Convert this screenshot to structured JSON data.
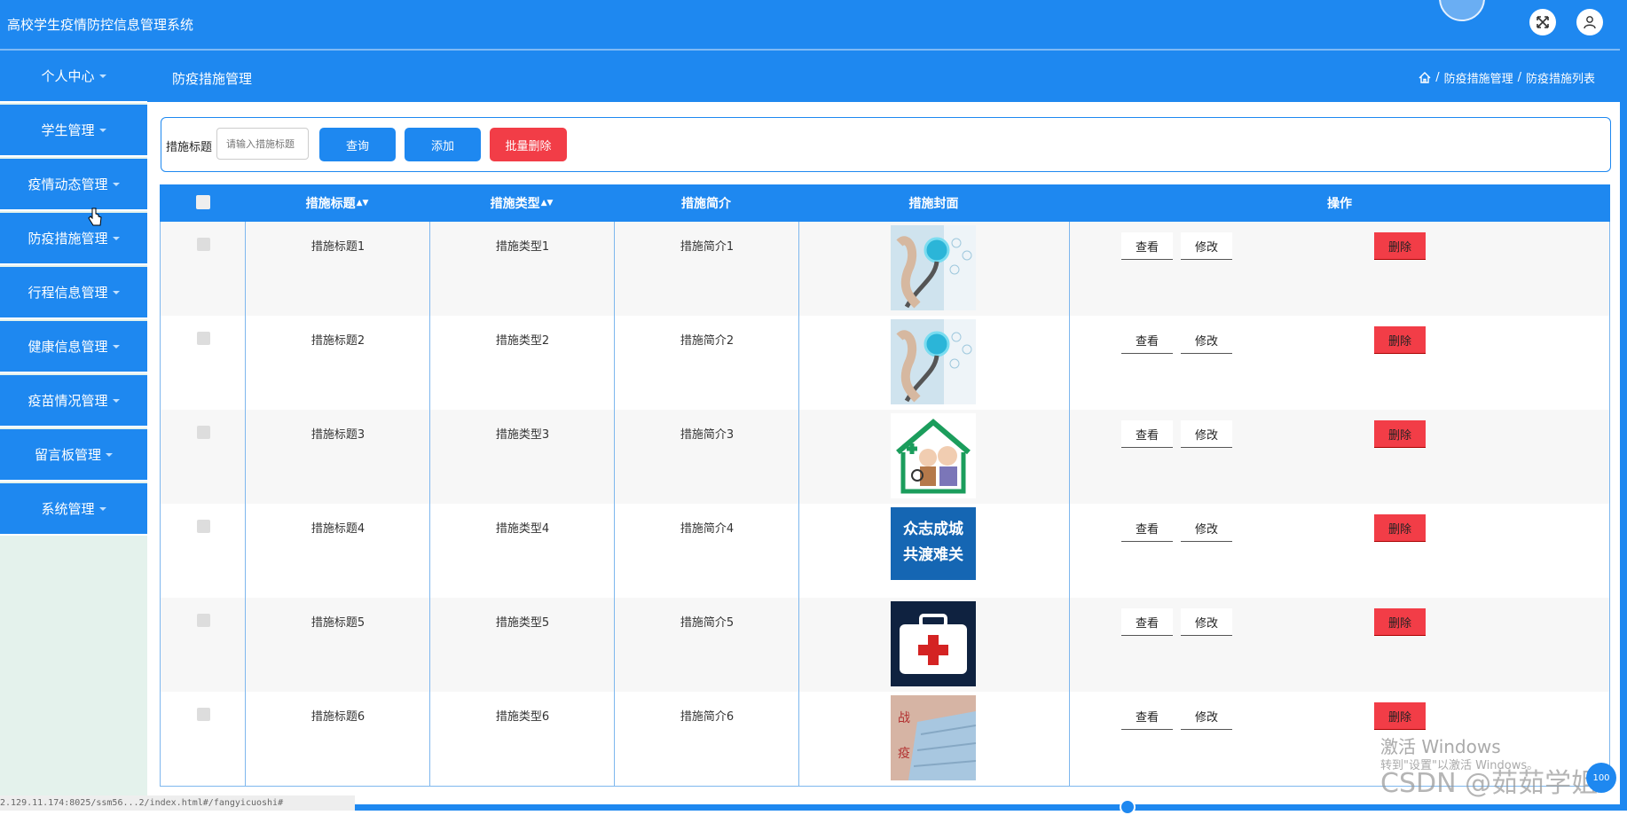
{
  "app_title": "高校学生疫情防控信息管理系统",
  "sidebar": {
    "items": [
      {
        "label": "个人中心"
      },
      {
        "label": "学生管理"
      },
      {
        "label": "疫情动态管理"
      },
      {
        "label": "防疫措施管理"
      },
      {
        "label": "行程信息管理"
      },
      {
        "label": "健康信息管理"
      },
      {
        "label": "疫苗情况管理"
      },
      {
        "label": "留言板管理"
      },
      {
        "label": "系统管理"
      }
    ]
  },
  "page": {
    "title": "防疫措施管理",
    "breadcrumb": [
      "防疫措施管理",
      "防疫措施列表"
    ]
  },
  "search": {
    "label": "措施标题",
    "placeholder": "请输入措施标题",
    "query_button": "查询",
    "add_button": "添加",
    "batch_delete_button": "批量删除"
  },
  "table": {
    "headers": {
      "title": "措施标题",
      "type": "措施类型",
      "intro": "措施简介",
      "cover": "措施封面",
      "actions": "操作"
    },
    "action_labels": {
      "view": "查看",
      "edit": "修改",
      "delete": "删除"
    },
    "rows": [
      {
        "title": "措施标题1",
        "type": "措施类型1",
        "intro": "措施简介1",
        "cover": "stethoscope"
      },
      {
        "title": "措施标题2",
        "type": "措施类型2",
        "intro": "措施简介2",
        "cover": "stethoscope"
      },
      {
        "title": "措施标题3",
        "type": "措施类型3",
        "intro": "措施简介3",
        "cover": "house-elderly"
      },
      {
        "title": "措施标题4",
        "type": "措施类型4",
        "intro": "措施简介4",
        "cover": "poster",
        "cover_text": [
          "众志成城",
          "共渡难关"
        ]
      },
      {
        "title": "措施标题5",
        "type": "措施类型5",
        "intro": "措施简介5",
        "cover": "first-aid-kit"
      },
      {
        "title": "措施标题6",
        "type": "措施类型6",
        "intro": "措施简介6",
        "cover": "mask"
      }
    ]
  },
  "status_url": "2.129.11.174:8025/ssm56...2/index.html#/fangyicuoshi#",
  "watermark": {
    "line1": "激活 Windows",
    "line2": "转到\"设置\"以激活 Windows。",
    "csdn": "CSDN @茹茹学姐"
  },
  "colors": {
    "primary": "#1E88F0",
    "danger": "#F23D47",
    "sidebar_bg": "#e4f2ec"
  }
}
